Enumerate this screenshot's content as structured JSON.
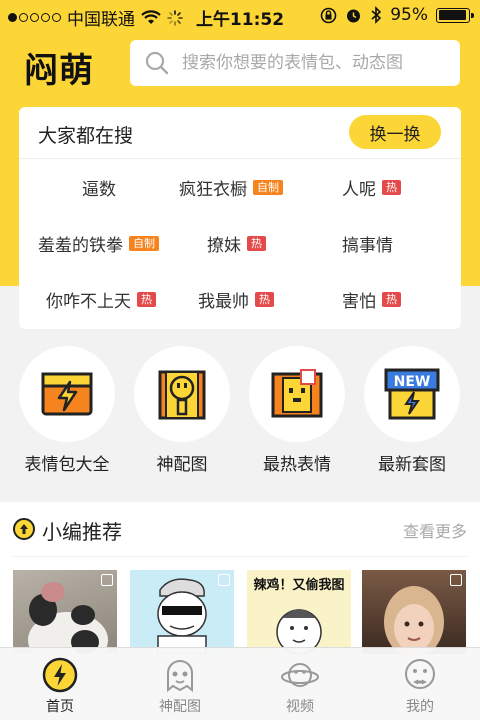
{
  "status_bar": {
    "carrier": "中国联通",
    "time": "上午11:52",
    "battery": "95%",
    "battery_level": 0.95
  },
  "header": {
    "logo": "闷萌",
    "search_placeholder": "搜索你想要的表情包、动态图"
  },
  "hot_search": {
    "title": "大家都在搜",
    "refresh_label": "换一换",
    "keywords": [
      {
        "text": "逼数",
        "tag": ""
      },
      {
        "text": "疯狂衣橱",
        "tag": "自制"
      },
      {
        "text": "人呢",
        "tag": "热"
      },
      {
        "text": "羞羞的铁拳",
        "tag": "自制"
      },
      {
        "text": "撩妹",
        "tag": "热"
      },
      {
        "text": "搞事情",
        "tag": ""
      },
      {
        "text": "你咋不上天",
        "tag": "热"
      },
      {
        "text": "我最帅",
        "tag": "热"
      },
      {
        "text": "害怕",
        "tag": "热"
      }
    ]
  },
  "categories": [
    {
      "label": "表情包大全",
      "icon": "lightning-box-icon"
    },
    {
      "label": "神配图",
      "icon": "face-frame-icon"
    },
    {
      "label": "最热表情",
      "icon": "hot-face-icon"
    },
    {
      "label": "最新套图",
      "icon": "new-box-icon"
    }
  ],
  "recommend": {
    "title": "小编推荐",
    "more": "查看更多",
    "thumbs": [
      {
        "name": "panda-thumb",
        "text": ""
      },
      {
        "name": "sunglasses-meme-thumb",
        "text": ""
      },
      {
        "name": "chicken-meme-thumb",
        "text": "辣鸡！又偷我图"
      },
      {
        "name": "girl-photo-thumb",
        "text": ""
      }
    ]
  },
  "tabbar": {
    "tabs": [
      {
        "label": "首页",
        "active": true
      },
      {
        "label": "神配图",
        "active": false
      },
      {
        "label": "视频",
        "active": false
      },
      {
        "label": "我的",
        "active": false
      }
    ]
  },
  "colors": {
    "brand_yellow": "#fcd637",
    "tag_self": "#f5841f",
    "tag_hot": "#e54a4a"
  }
}
